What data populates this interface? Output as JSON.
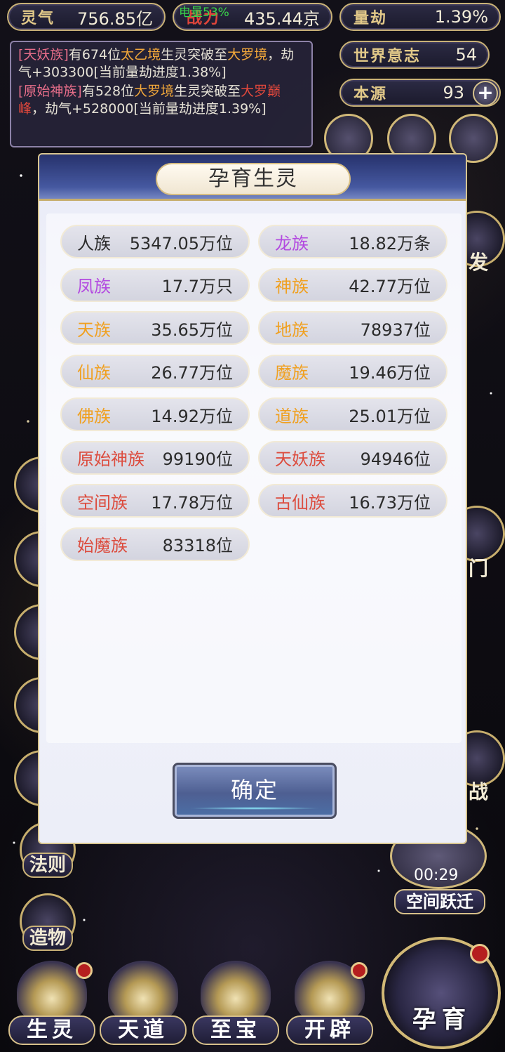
{
  "status": {
    "battery": "电量53%"
  },
  "stats": {
    "lingqi": {
      "label": "灵气",
      "value": "756.85亿"
    },
    "power": {
      "label": "战力",
      "value": "435.44京"
    },
    "liangjie": {
      "label": "量劫",
      "value": "1.39%"
    },
    "shijie": {
      "label": "世界意志",
      "value": "54"
    },
    "benyuan": {
      "label": "本源",
      "value": "93"
    }
  },
  "log": [
    {
      "p1": "[天妖族]",
      "p2": "有674位",
      "p3": "太乙境",
      "p4": "生灵突破至",
      "p5": "大罗境",
      "p6": "，劫气+303300[当前量劫进度1.38%]"
    },
    {
      "p1": "[原始神族]",
      "p2": "有528位",
      "p3": "大罗境",
      "p4": "生灵突破至",
      "p5": "大罗巅峰",
      "p6": "，劫气+528000[当前量劫进度1.39%]"
    }
  ],
  "modal": {
    "title": "孕育生灵",
    "confirm": "确定",
    "races": [
      {
        "name": "人族",
        "count": "5347.05万位",
        "color": "#2b2b2b"
      },
      {
        "name": "龙族",
        "count": "18.82万条",
        "color": "#b34ae0"
      },
      {
        "name": "凤族",
        "count": "17.7万只",
        "color": "#b34ae0"
      },
      {
        "name": "神族",
        "count": "42.77万位",
        "color": "#f0a020"
      },
      {
        "name": "天族",
        "count": "35.65万位",
        "color": "#f0a020"
      },
      {
        "name": "地族",
        "count": "78937位",
        "color": "#f0a020"
      },
      {
        "name": "仙族",
        "count": "26.77万位",
        "color": "#f0a020"
      },
      {
        "name": "魔族",
        "count": "19.46万位",
        "color": "#f0a020"
      },
      {
        "name": "佛族",
        "count": "14.92万位",
        "color": "#f0a020"
      },
      {
        "name": "道族",
        "count": "25.01万位",
        "color": "#f0a020"
      },
      {
        "name": "原始神族",
        "count": "99190位",
        "color": "#dc4c3e"
      },
      {
        "name": "天妖族",
        "count": "94946位",
        "color": "#dc4c3e"
      },
      {
        "name": "空间族",
        "count": "17.78万位",
        "color": "#dc4c3e"
      },
      {
        "name": "古仙族",
        "count": "16.73万位",
        "color": "#dc4c3e"
      },
      {
        "name": "始魔族",
        "count": "83318位",
        "color": "#dc4c3e"
      }
    ]
  },
  "side": {
    "fazi": "法则",
    "zaowu": "造物",
    "right_fa": "发",
    "right_men": "门",
    "right_zhan": "战"
  },
  "timer": {
    "time": "00:29",
    "label": "空间跃迁"
  },
  "nav": {
    "shengling": "生灵",
    "tiandao": "天道",
    "zhibao": "至宝",
    "kaipi": "开辟",
    "yunyu": "孕育"
  }
}
